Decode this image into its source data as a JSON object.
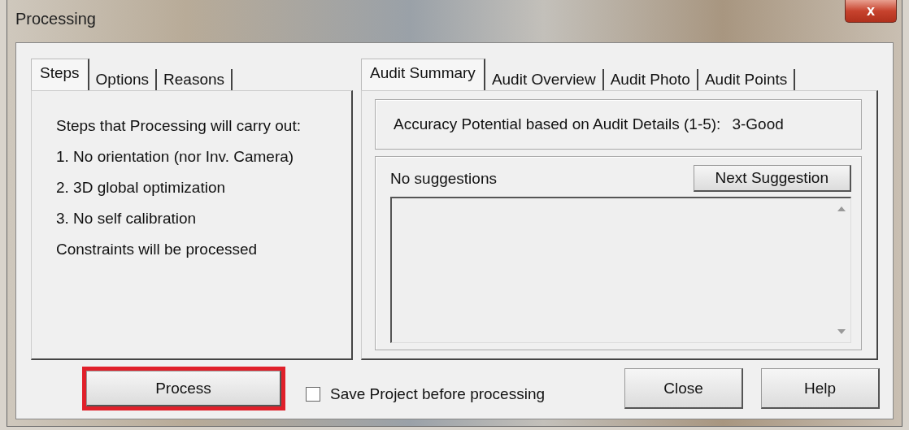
{
  "window": {
    "title": "Processing",
    "close_label": "x"
  },
  "left_tabs": [
    {
      "label": "Steps",
      "selected": true
    },
    {
      "label": "Options",
      "selected": false
    },
    {
      "label": "Reasons",
      "selected": false
    }
  ],
  "steps": {
    "heading": "Steps that Processing will carry out:",
    "lines": [
      "1. No orientation (nor Inv. Camera)",
      "2. 3D global optimization",
      "3. No self calibration",
      "Constraints will be processed"
    ]
  },
  "right_tabs": [
    {
      "label": "Audit Summary",
      "selected": true
    },
    {
      "label": "Audit Overview",
      "selected": false
    },
    {
      "label": "Audit Photo",
      "selected": false
    },
    {
      "label": "Audit Points",
      "selected": false
    }
  ],
  "accuracy": {
    "label": "Accuracy Potential based on Audit Details (1-5):",
    "value": "3-Good"
  },
  "suggestions": {
    "label": "No suggestions",
    "button": "Next Suggestion"
  },
  "footer": {
    "process_button": {
      "label": "Process",
      "highlighted": true
    },
    "save_checkbox": {
      "label": "Save Project before processing",
      "checked": false
    },
    "buttons": [
      "Close",
      "Help"
    ]
  }
}
